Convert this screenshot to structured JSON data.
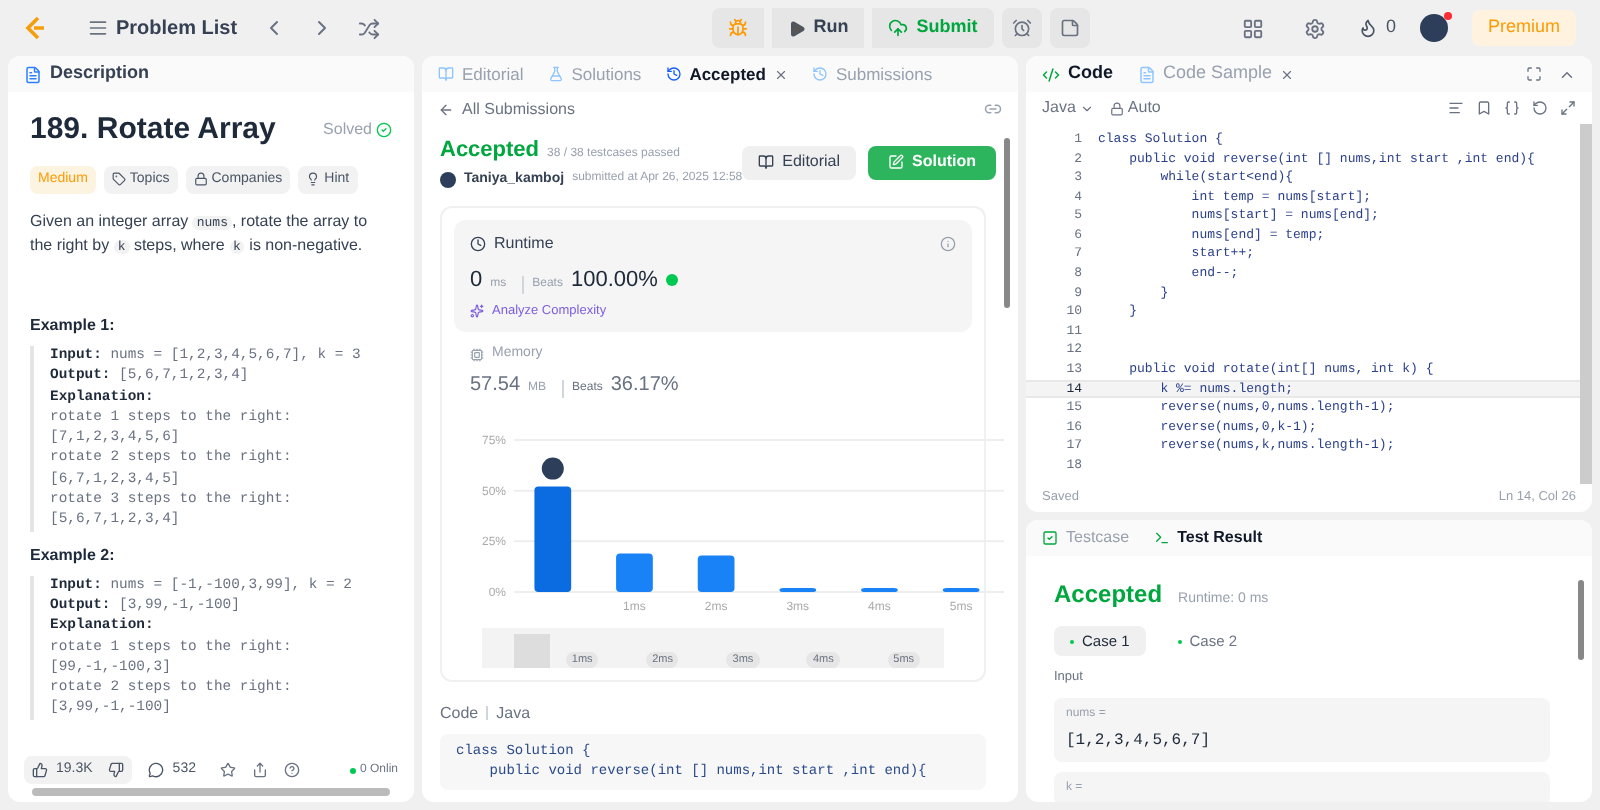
{
  "topbar": {
    "problem_list": "Problem List",
    "run": "Run",
    "submit": "Submit",
    "streak": "0",
    "premium": "Premium"
  },
  "description": {
    "tab": "Description",
    "title": "189. Rotate Array",
    "status": "Solved",
    "difficulty": "Medium",
    "tags": [
      "Topics",
      "Companies",
      "Hint"
    ],
    "paragraph": [
      {
        "kind": "text",
        "text": "Given an integer array "
      },
      {
        "kind": "code",
        "text": "nums"
      },
      {
        "kind": "text",
        "text": ", rotate the array to the right by "
      },
      {
        "kind": "code",
        "text": "k"
      },
      {
        "kind": "text",
        "text": " steps, where "
      },
      {
        "kind": "code",
        "text": "k"
      },
      {
        "kind": "text",
        "text": " is non-negative."
      }
    ],
    "examples": [
      {
        "title": "Example 1:",
        "lines": [
          {
            "kind": "field",
            "label": "Input:",
            "text": "nums = [1,2,3,4,5,6,7], k = 3"
          },
          {
            "kind": "field",
            "label": "Output:",
            "text": "[5,6,7,1,2,3,4]"
          },
          {
            "kind": "field",
            "label": "Explanation:"
          },
          {
            "kind": "plain",
            "text": "rotate 1 steps to the right:"
          },
          {
            "kind": "plain",
            "text": "[7,1,2,3,4,5,6]"
          },
          {
            "kind": "plain",
            "text": "rotate 2 steps to the right:"
          },
          {
            "kind": "plain",
            "text": "[6,7,1,2,3,4,5]"
          },
          {
            "kind": "plain",
            "text": "rotate 3 steps to the right:"
          },
          {
            "kind": "plain",
            "text": "[5,6,7,1,2,3,4]"
          }
        ]
      },
      {
        "title": "Example 2:",
        "lines": [
          {
            "kind": "field",
            "label": "Input:",
            "text": "nums = [-1,-100,3,99], k = 2"
          },
          {
            "kind": "field",
            "label": "Output:",
            "text": "[3,99,-1,-100]"
          },
          {
            "kind": "field",
            "label": "Explanation:"
          },
          {
            "kind": "plain",
            "text": "rotate 1 steps to the right:"
          },
          {
            "kind": "plain",
            "text": "[99,-1,-100,3]"
          },
          {
            "kind": "plain",
            "text": "rotate 2 steps to the right:"
          },
          {
            "kind": "plain",
            "text": "[3,99,-1,-100]"
          }
        ]
      }
    ],
    "likes": "19.3K",
    "comments": "532",
    "online": "0 Onlin"
  },
  "submission": {
    "tabs": [
      {
        "label": "Editorial",
        "selected": false
      },
      {
        "label": "Solutions",
        "selected": false
      },
      {
        "label": "Accepted",
        "selected": true
      },
      {
        "label": "Submissions",
        "selected": false
      }
    ],
    "back": "All Submissions",
    "status": "Accepted",
    "passed": "38 / 38 testcases passed",
    "user": "Taniya_kamboj",
    "submitted": "submitted at Apr 26, 2025 12:58",
    "editorial_button": "Editorial",
    "solution_button": "Solution",
    "runtime": {
      "label": "Runtime",
      "value": "0",
      "unit": "ms",
      "beats_label": "Beats",
      "beats": "100.00%",
      "analyze": "Analyze Complexity"
    },
    "memory": {
      "label": "Memory",
      "value": "57.54",
      "unit": "MB",
      "beats_label": "Beats",
      "beats": "36.17%"
    },
    "chart_data": {
      "type": "bar",
      "categories": [
        null,
        "1ms",
        "2ms",
        "3ms",
        "4ms",
        "5ms"
      ],
      "values": [
        52,
        19,
        18,
        2,
        2,
        2
      ],
      "ylim": [
        0,
        75
      ],
      "yticks": [
        {
          "value": 0,
          "label": "0%"
        },
        {
          "value": 25,
          "label": "25%"
        },
        {
          "value": 50,
          "label": "50%"
        },
        {
          "value": 75,
          "label": "75%"
        }
      ]
    },
    "brush_labels": [
      "1ms",
      "2ms",
      "3ms",
      "4ms",
      "5ms"
    ],
    "code_header": [
      "Code",
      "Java"
    ],
    "code": [
      "class Solution {",
      "    public void reverse(int [] nums,int start ,int end){"
    ]
  },
  "editor": {
    "tabs": [
      {
        "label": "Code",
        "selected": true
      },
      {
        "label": "Code Sample",
        "selected": false
      }
    ],
    "language": "Java",
    "mode": "Auto",
    "lines": [
      {
        "number": "1",
        "text": "class Solution {",
        "highlighted": false
      },
      {
        "number": "2",
        "text": "    public void reverse(int [] nums,int start ,int end){",
        "highlighted": false
      },
      {
        "number": "3",
        "text": "        while(start<end){",
        "highlighted": false
      },
      {
        "number": "4",
        "text": "            int temp = nums[start];",
        "highlighted": false
      },
      {
        "number": "5",
        "text": "            nums[start] = nums[end];",
        "highlighted": false
      },
      {
        "number": "6",
        "text": "            nums[end] = temp;",
        "highlighted": false
      },
      {
        "number": "7",
        "text": "            start++;",
        "highlighted": false
      },
      {
        "number": "8",
        "text": "            end--;",
        "highlighted": false
      },
      {
        "number": "9",
        "text": "        }",
        "highlighted": false
      },
      {
        "number": "10",
        "text": "    }",
        "highlighted": false
      },
      {
        "number": "11",
        "highlighted": false
      },
      {
        "number": "12",
        "highlighted": false
      },
      {
        "number": "13",
        "text": "    public void rotate(int[] nums, int k) {",
        "highlighted": false
      },
      {
        "number": "14",
        "text": "        k %= nums.length;",
        "highlighted": true
      },
      {
        "number": "15",
        "text": "        reverse(nums,0,nums.length-1);",
        "highlighted": false
      },
      {
        "number": "16",
        "text": "        reverse(nums,0,k-1);",
        "highlighted": false
      },
      {
        "number": "17",
        "text": "        reverse(nums,k,nums.length-1);",
        "highlighted": false
      },
      {
        "number": "18",
        "highlighted": false
      }
    ],
    "saved": "Saved",
    "cursor": "Ln 14, Col 26"
  },
  "test": {
    "tabs": [
      {
        "label": "Testcase",
        "selected": false
      },
      {
        "label": "Test Result",
        "selected": true
      }
    ],
    "result": "Accepted",
    "runtime": "Runtime: 0 ms",
    "cases": [
      {
        "label": "Case 1",
        "selected": true
      },
      {
        "label": "Case 2",
        "selected": false
      }
    ],
    "input_label": "Input",
    "inputs": [
      {
        "name": "nums =",
        "value": "[1,2,3,4,5,6,7]"
      },
      {
        "name": "k ="
      }
    ]
  }
}
